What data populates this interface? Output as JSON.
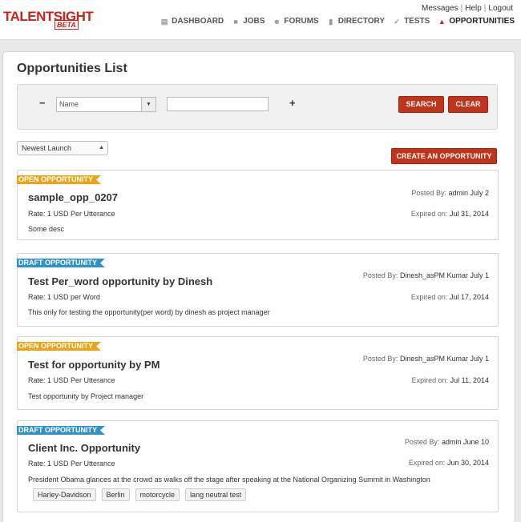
{
  "header": {
    "logo_talent": "TALENT",
    "logo_sight": "SIGHT",
    "logo_beta": "BETA",
    "top_links": [
      "Messages",
      "Help",
      "Logout"
    ],
    "nav": [
      {
        "label": "DASHBOARD",
        "icon": "dashboard-icon"
      },
      {
        "label": "JOBS",
        "icon": "briefcase-icon"
      },
      {
        "label": "FORUMS",
        "icon": "people-icon"
      },
      {
        "label": "DIRECTORY",
        "icon": "book-icon"
      },
      {
        "label": "TESTS",
        "icon": "check-icon"
      },
      {
        "label": "OPPORTUNITIES",
        "icon": "flame-icon",
        "active": true
      }
    ]
  },
  "main": {
    "title": "Opportunities List",
    "filter": {
      "minus": "−",
      "plus": "+",
      "field_select": "Name",
      "value_input": "",
      "search_label": "SEARCH",
      "clear_label": "CLEAR"
    },
    "sort_select": "Newest Launch",
    "create_label": "CREATE AN OPPORTUNITY"
  },
  "opportunities": [
    {
      "status": "OPEN OPPORTUNITY",
      "title": "sample_opp_0207",
      "rate": "Rate: 1 USD Per Utterance",
      "description": "Some desc",
      "posted_by_label": "Posted By:",
      "posted_by": "admin July 2",
      "expired_label": "Expired on:",
      "expired": "Jul 31, 2014",
      "tags": []
    },
    {
      "status": "DRAFT OPPORTUNITY",
      "title": "Test Per_word opportunity by Dinesh",
      "rate": "Rate: 1 USD per Word",
      "description": "This only for testing the opportunity(per word) by dinesh as project manager",
      "posted_by_label": "Posted By:",
      "posted_by": "Dinesh_asPM Kumar July 1",
      "expired_label": "Expired on:",
      "expired": "Jul 17, 2014",
      "tags": []
    },
    {
      "status": "OPEN OPPORTUNITY",
      "title": "Test for opportunity by PM",
      "rate": "Rate: 1 USD Per Utterance",
      "description": "Test opportunity by Project manager",
      "posted_by_label": "Posted By:",
      "posted_by": "Dinesh_asPM Kumar July 1",
      "expired_label": "Expired on:",
      "expired": "Jul 11, 2014",
      "tags": []
    },
    {
      "status": "DRAFT OPPORTUNITY",
      "title": "Client Inc. Opportunity",
      "rate": "Rate: 1 USD Per Utterance",
      "description": "President Obama glances at the crowd as walks off the stage after speaking at the National Organizing Summit in Washington",
      "posted_by_label": "Posted By:",
      "posted_by": "admin June 10",
      "expired_label": "Expired on:",
      "expired": "Jun 30, 2014",
      "tags": [
        "Harley-Davidson",
        "Berlin",
        "motorcycle",
        "lang neutral test"
      ]
    }
  ],
  "colors": {
    "brand_red": "#c8231c",
    "button_red": "#c1341c",
    "open_ribbon": "#e9a516",
    "draft_ribbon": "#2f92c9"
  }
}
